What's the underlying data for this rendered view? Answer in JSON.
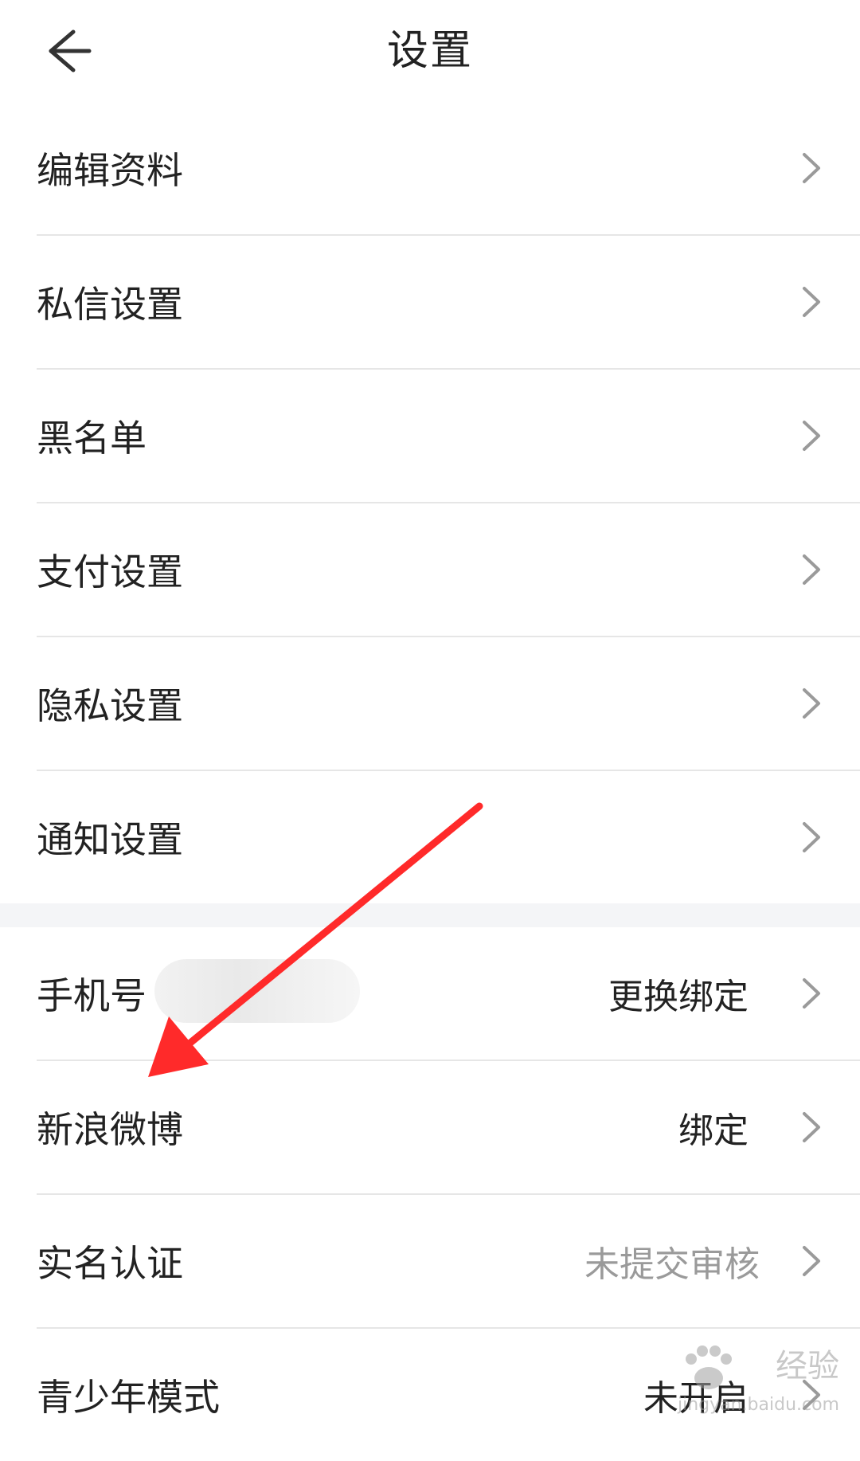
{
  "header": {
    "title": "设置"
  },
  "rows": [
    {
      "label": "编辑资料",
      "value": ""
    },
    {
      "label": "私信设置",
      "value": ""
    },
    {
      "label": "黑名单",
      "value": ""
    },
    {
      "label": "支付设置",
      "value": ""
    },
    {
      "label": "隐私设置",
      "value": ""
    },
    {
      "label": "通知设置",
      "value": ""
    }
  ],
  "account_rows": [
    {
      "label": "手机号",
      "value": "更换绑定"
    },
    {
      "label": "新浪微博",
      "value": "绑定"
    },
    {
      "label": "实名认证",
      "value": "未提交审核"
    },
    {
      "label": "青少年模式",
      "value": "未开启"
    }
  ],
  "watermark": {
    "brand": "经验",
    "url": "jingyan.baidu.com"
  },
  "colors": {
    "annotation_arrow": "#ff2a2a",
    "muted_text": "#9a9a9a",
    "divider": "#e6e6e6",
    "section_gap": "#f4f5f7"
  },
  "icons": {
    "back": "back-arrow-icon",
    "chevron": "chevron-right-icon"
  }
}
